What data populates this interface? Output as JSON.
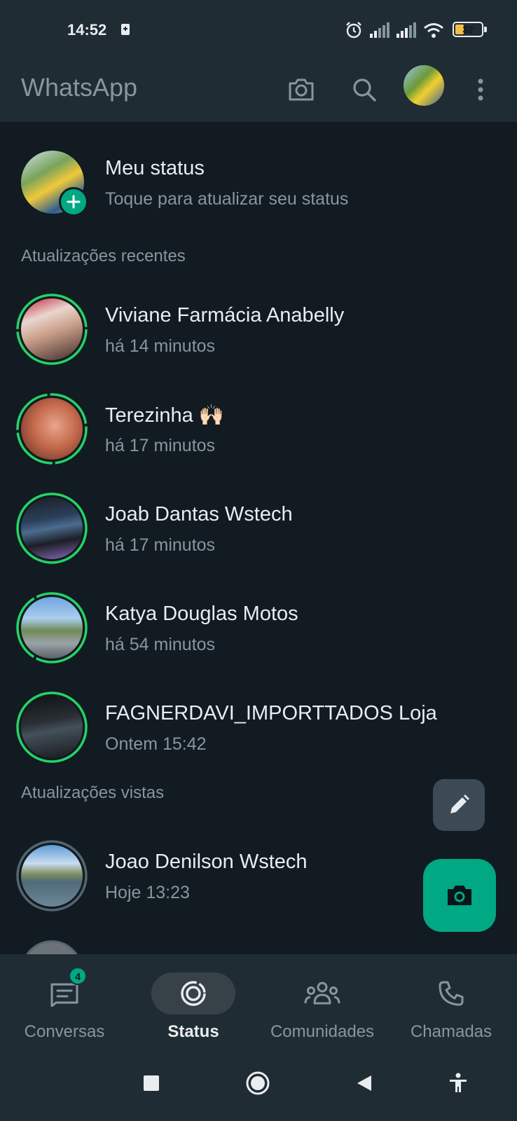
{
  "status_bar": {
    "time": "14:52",
    "battery": "32",
    "battery_level": 0.32
  },
  "app_bar": {
    "title": "WhatsApp"
  },
  "my_status": {
    "name": "Meu status",
    "subtitle": "Toque para atualizar seu status"
  },
  "sections": {
    "recent": "Atualizações recentes",
    "viewed": "Atualizações vistas"
  },
  "recent": [
    {
      "name": "Viviane Farmácia Anabelly",
      "time": "há 14 minutos"
    },
    {
      "name": "Terezinha 🙌🏻",
      "time": "há 17 minutos"
    },
    {
      "name": "Joab Dantas Wstech",
      "time": "há 17 minutos"
    },
    {
      "name": "Katya Douglas Motos",
      "time": "há 54 minutos"
    },
    {
      "name": "FAGNERDAVI_IMPORTTADOS Loja",
      "time": "Ontem 15:42"
    }
  ],
  "viewed": [
    {
      "name": "Joao Denilson Wstech",
      "time": "Hoje 13:23"
    }
  ],
  "bottom_nav": {
    "items": [
      {
        "label": "Conversas",
        "badge": "4"
      },
      {
        "label": "Status"
      },
      {
        "label": "Comunidades"
      },
      {
        "label": "Chamadas"
      }
    ]
  },
  "colors": {
    "accent": "#00a884",
    "background": "#111b21",
    "bar": "#202c33",
    "muted": "#8696a0"
  }
}
